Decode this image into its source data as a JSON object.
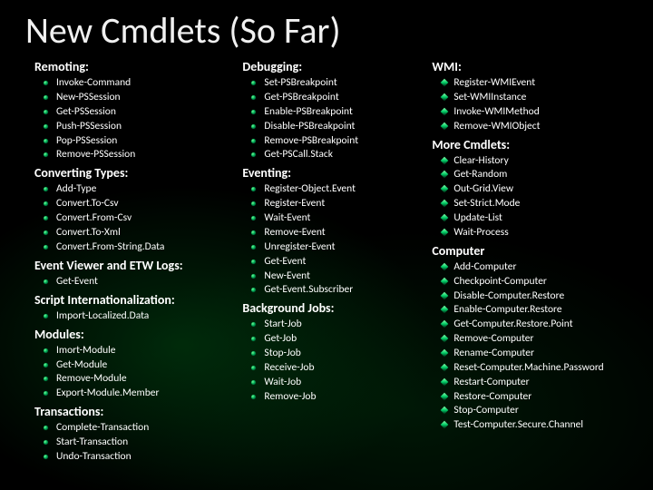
{
  "title": "New Cmdlets (So Far)",
  "columns": [
    {
      "sections": [
        {
          "heading": "Remoting:",
          "items": [
            "Invoke-Command",
            "New-PSSession",
            "Get-PSSession",
            "Push-PSSession",
            "Pop-PSSession",
            "Remove-PSSession"
          ]
        },
        {
          "heading": "Converting Types:",
          "items": [
            "Add-Type",
            "Convert.To-Csv",
            "Convert.From-Csv",
            "Convert.To-Xml",
            "Convert.From-String.Data"
          ]
        },
        {
          "heading": "Event Viewer and ETW Logs:",
          "items": [
            "Get-Event"
          ]
        },
        {
          "heading": "Script Internationalization:",
          "items": [
            "Import-Localized.Data"
          ]
        },
        {
          "heading": "Modules:",
          "items": [
            "Imort-Module",
            "Get-Module",
            "Remove-Module",
            "Export-Module.Member"
          ]
        },
        {
          "heading": "Transactions:",
          "items": [
            "Complete-Transaction",
            "Start-Transaction",
            "Undo-Transaction"
          ]
        }
      ]
    },
    {
      "sections": [
        {
          "heading": "Debugging:",
          "items": [
            "Set-PSBreakpoint",
            "Get-PSBreakpoint",
            "Enable-PSBreakpoint",
            "Disable-PSBreakpoint",
            "Remove-PSBreakpoint",
            "Get-PSCall.Stack"
          ]
        },
        {
          "heading": "Eventing:",
          "items": [
            "Register-Object.Event",
            "Register-Event",
            "Wait-Event",
            "Remove-Event",
            "Unregister-Event",
            "Get-Event",
            "New-Event",
            "Get-Event.Subscriber"
          ]
        },
        {
          "heading": "Background Jobs:",
          "items": [
            "Start-Job",
            "Get-Job",
            "Stop-Job",
            "Receive-Job",
            "Wait-Job",
            "Remove-Job"
          ]
        }
      ]
    },
    {
      "sections": [
        {
          "heading": "WMI:",
          "items": [
            "Register-WMIEvent",
            "Set-WMIInstance",
            "Invoke-WMIMethod",
            "Remove-WMIObject"
          ]
        },
        {
          "heading": "More Cmdlets:",
          "items": [
            "Clear-History",
            "Get-Random",
            "Out-Grid.View",
            "Set-Strict.Mode",
            "Update-List",
            "Wait-Process"
          ]
        },
        {
          "heading": "Computer",
          "items": [
            "Add-Computer",
            "Checkpoint-Computer",
            "Disable-Computer.Restore",
            "Enable-Computer.Restore",
            "Get-Computer.Restore.Point",
            "Remove-Computer",
            "Rename-Computer",
            "Reset-Computer.Machine.Password",
            "Restart-Computer",
            "Restore-Computer",
            "Stop-Computer",
            "Test-Computer.Secure.Channel"
          ]
        }
      ]
    }
  ]
}
